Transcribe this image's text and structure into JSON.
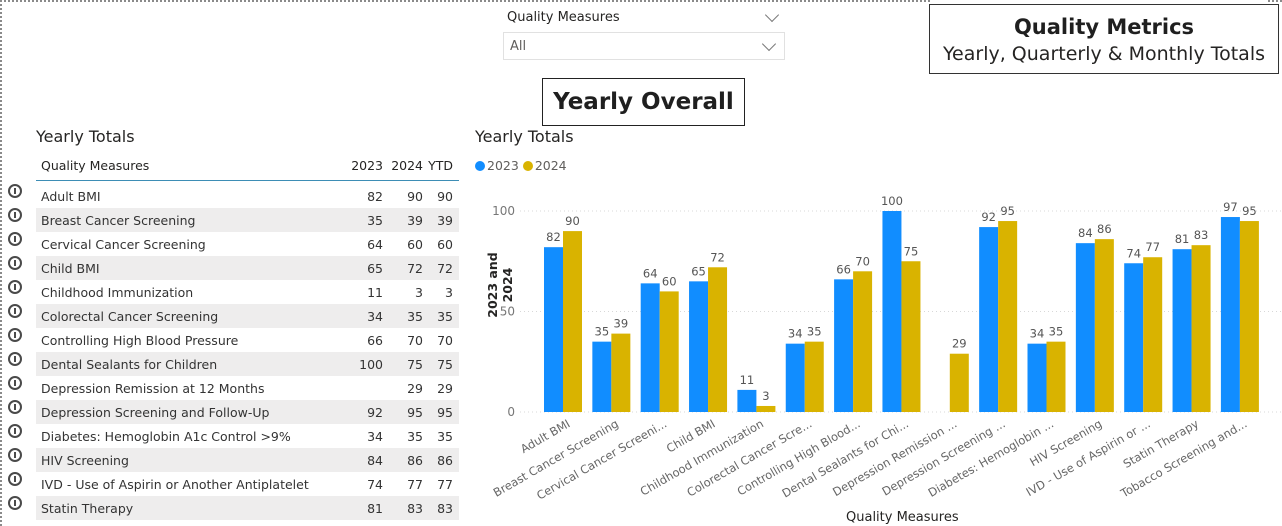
{
  "header": {
    "title": "Quality Metrics",
    "subtitle": "Yearly, Quarterly & Monthly Totals",
    "section_title": "Yearly Overall"
  },
  "slicer": {
    "label": "Quality Measures",
    "selected": "All"
  },
  "table": {
    "title": "Yearly Totals",
    "columns": [
      "Quality Measures",
      "2023",
      "2024",
      "YTD"
    ],
    "rows": [
      {
        "name": "Adult BMI",
        "y2023": "82",
        "y2024": "90",
        "ytd": "90"
      },
      {
        "name": "Breast Cancer Screening",
        "y2023": "35",
        "y2024": "39",
        "ytd": "39"
      },
      {
        "name": "Cervical Cancer Screening",
        "y2023": "64",
        "y2024": "60",
        "ytd": "60"
      },
      {
        "name": "Child BMI",
        "y2023": "65",
        "y2024": "72",
        "ytd": "72"
      },
      {
        "name": "Childhood Immunization",
        "y2023": "11",
        "y2024": "3",
        "ytd": "3"
      },
      {
        "name": "Colorectal Cancer Screening",
        "y2023": "34",
        "y2024": "35",
        "ytd": "35"
      },
      {
        "name": "Controlling High Blood Pressure",
        "y2023": "66",
        "y2024": "70",
        "ytd": "70"
      },
      {
        "name": "Dental Sealants for Children",
        "y2023": "100",
        "y2024": "75",
        "ytd": "75"
      },
      {
        "name": "Depression Remission at 12 Months",
        "y2023": "",
        "y2024": "29",
        "ytd": "29"
      },
      {
        "name": "Depression Screening and Follow-Up",
        "y2023": "92",
        "y2024": "95",
        "ytd": "95"
      },
      {
        "name": "Diabetes: Hemoglobin A1c Control >9%",
        "y2023": "34",
        "y2024": "35",
        "ytd": "35"
      },
      {
        "name": "HIV Screening",
        "y2023": "84",
        "y2024": "86",
        "ytd": "86"
      },
      {
        "name": "IVD - Use of Aspirin or Another Antiplatelet",
        "y2023": "74",
        "y2024": "77",
        "ytd": "77"
      },
      {
        "name": "Statin Therapy",
        "y2023": "81",
        "y2024": "83",
        "ytd": "83"
      }
    ]
  },
  "colors": {
    "series_2023": "#118dff",
    "series_2024": "#d9b300"
  },
  "chart_data": {
    "type": "bar",
    "title": "Yearly Totals",
    "xlabel": "Quality Measures",
    "ylabel": "2023 and 2024",
    "ylim": [
      0,
      100
    ],
    "yticks": [
      "0",
      "50",
      "100"
    ],
    "grid": true,
    "legend": "top-left",
    "categories": [
      "Adult BMI",
      "Breast Cancer Screening",
      "Cervical Cancer Screeni...",
      "Child BMI",
      "Childhood Immunization",
      "Colorectal Cancer Scre...",
      "Controlling High Blood...",
      "Dental Sealants for Chi...",
      "Depression Remission ...",
      "Depression Screening ...",
      "Diabetes: Hemoglobin ...",
      "HIV Screening",
      "IVD - Use of Aspirin or ...",
      "Statin Therapy",
      "Tobacco Screening and..."
    ],
    "series": [
      {
        "name": "2023",
        "values": [
          82,
          35,
          64,
          65,
          11,
          34,
          66,
          100,
          null,
          92,
          34,
          84,
          74,
          81,
          97
        ]
      },
      {
        "name": "2024",
        "values": [
          90,
          39,
          60,
          72,
          3,
          35,
          70,
          75,
          29,
          95,
          35,
          86,
          77,
          83,
          95
        ]
      }
    ]
  }
}
